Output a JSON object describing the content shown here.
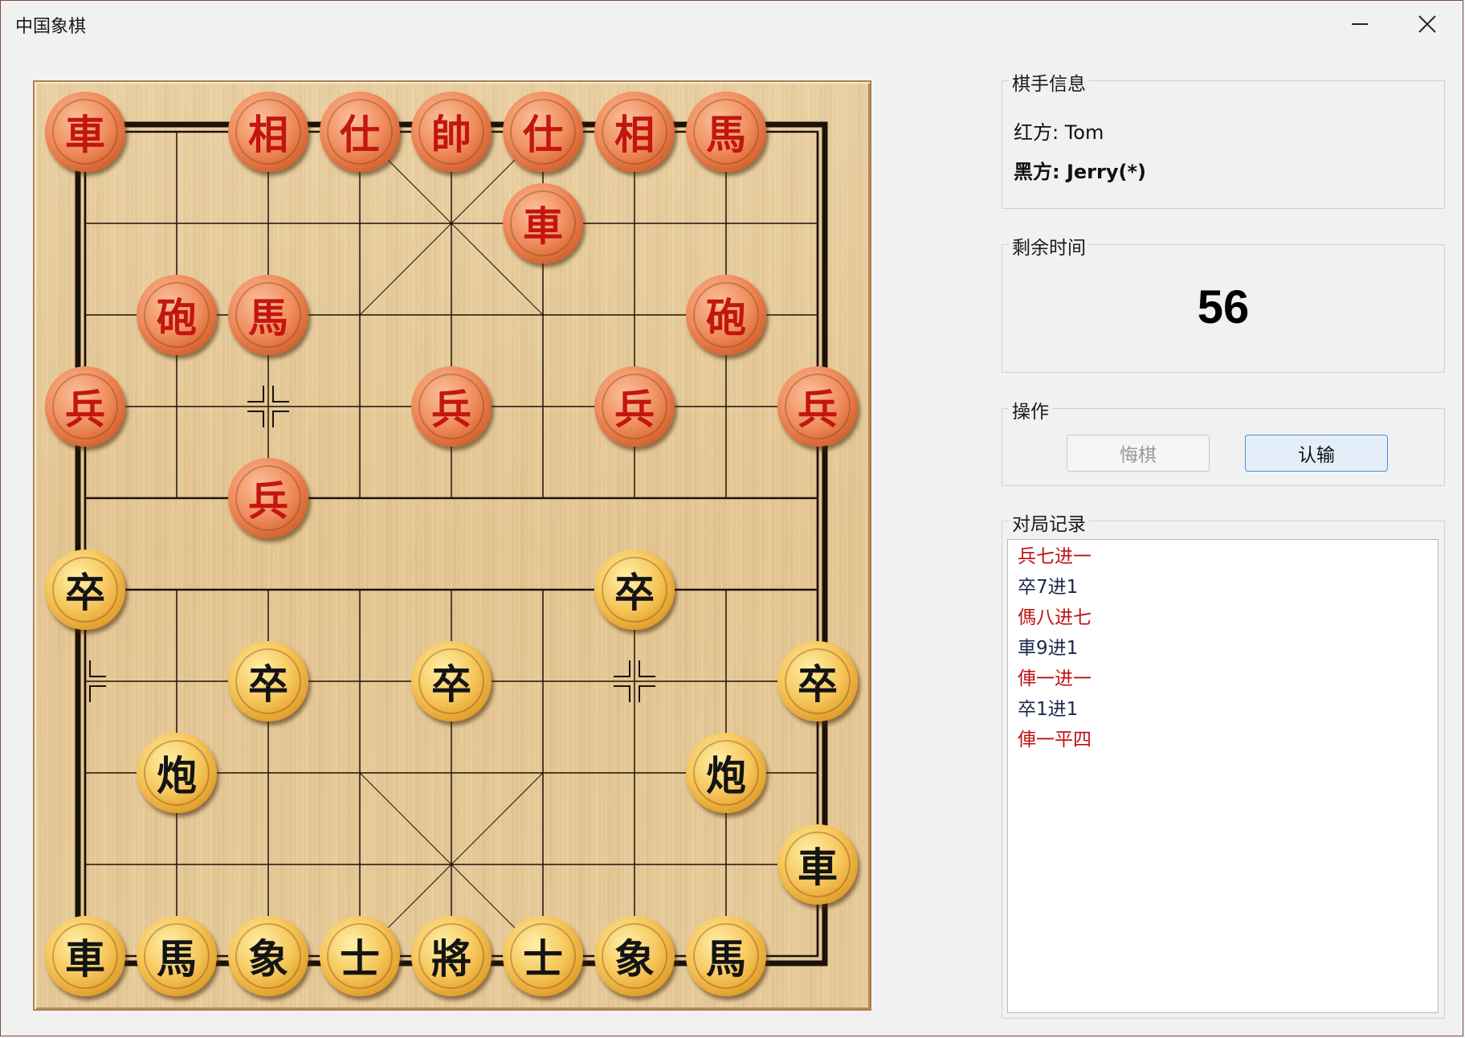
{
  "window": {
    "title": "中国象棋",
    "controls": [
      "minimize",
      "close"
    ]
  },
  "player_info": {
    "label": "棋手信息",
    "red": "红方: Tom",
    "black": "黑方: Jerry(*)"
  },
  "timer": {
    "label": "剩余时间",
    "value": "56"
  },
  "operations": {
    "label": "操作",
    "undo": "悔棋",
    "undo_enabled": false,
    "resign": "认输"
  },
  "move_log": {
    "label": "对局记录",
    "moves": [
      {
        "text": "兵七进一",
        "side": "red"
      },
      {
        "text": "卒7进1",
        "side": "black"
      },
      {
        "text": "傌八进七",
        "side": "red"
      },
      {
        "text": "車9进1",
        "side": "black"
      },
      {
        "text": "俥一进一",
        "side": "red"
      },
      {
        "text": "卒1进1",
        "side": "black"
      },
      {
        "text": "俥一平四",
        "side": "red"
      }
    ]
  },
  "board": {
    "files": 9,
    "ranks": 10,
    "pieces": [
      {
        "char": "車",
        "side": "red",
        "file": 0,
        "rank": 0
      },
      {
        "char": "相",
        "side": "red",
        "file": 2,
        "rank": 0
      },
      {
        "char": "仕",
        "side": "red",
        "file": 3,
        "rank": 0
      },
      {
        "char": "帥",
        "side": "red",
        "file": 4,
        "rank": 0
      },
      {
        "char": "仕",
        "side": "red",
        "file": 5,
        "rank": 0
      },
      {
        "char": "相",
        "side": "red",
        "file": 6,
        "rank": 0
      },
      {
        "char": "馬",
        "side": "red",
        "file": 7,
        "rank": 0
      },
      {
        "char": "車",
        "side": "red",
        "file": 5,
        "rank": 1
      },
      {
        "char": "砲",
        "side": "red",
        "file": 1,
        "rank": 2
      },
      {
        "char": "馬",
        "side": "red",
        "file": 2,
        "rank": 2
      },
      {
        "char": "砲",
        "side": "red",
        "file": 7,
        "rank": 2
      },
      {
        "char": "兵",
        "side": "red",
        "file": 0,
        "rank": 3
      },
      {
        "char": "兵",
        "side": "red",
        "file": 4,
        "rank": 3
      },
      {
        "char": "兵",
        "side": "red",
        "file": 6,
        "rank": 3
      },
      {
        "char": "兵",
        "side": "red",
        "file": 8,
        "rank": 3
      },
      {
        "char": "兵",
        "side": "red",
        "file": 2,
        "rank": 4
      },
      {
        "char": "卒",
        "side": "black",
        "file": 0,
        "rank": 5
      },
      {
        "char": "卒",
        "side": "black",
        "file": 6,
        "rank": 5
      },
      {
        "char": "卒",
        "side": "black",
        "file": 2,
        "rank": 6
      },
      {
        "char": "卒",
        "side": "black",
        "file": 4,
        "rank": 6
      },
      {
        "char": "卒",
        "side": "black",
        "file": 8,
        "rank": 6
      },
      {
        "char": "炮",
        "side": "black",
        "file": 1,
        "rank": 7
      },
      {
        "char": "炮",
        "side": "black",
        "file": 7,
        "rank": 7
      },
      {
        "char": "車",
        "side": "black",
        "file": 8,
        "rank": 8
      },
      {
        "char": "車",
        "side": "black",
        "file": 0,
        "rank": 9
      },
      {
        "char": "馬",
        "side": "black",
        "file": 1,
        "rank": 9
      },
      {
        "char": "象",
        "side": "black",
        "file": 2,
        "rank": 9
      },
      {
        "char": "士",
        "side": "black",
        "file": 3,
        "rank": 9
      },
      {
        "char": "將",
        "side": "black",
        "file": 4,
        "rank": 9
      },
      {
        "char": "士",
        "side": "black",
        "file": 5,
        "rank": 9
      },
      {
        "char": "象",
        "side": "black",
        "file": 6,
        "rank": 9
      },
      {
        "char": "馬",
        "side": "black",
        "file": 7,
        "rank": 9
      }
    ]
  },
  "colors": {
    "red_text": "#c01010",
    "black_text": "#1a2a4a",
    "accent_border": "#4a8fd9"
  }
}
